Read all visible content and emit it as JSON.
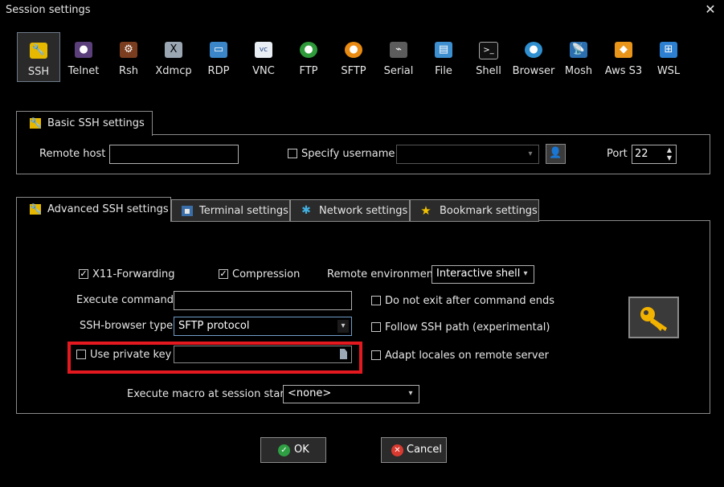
{
  "window": {
    "title": "Session settings",
    "close_label": "✕"
  },
  "protocols": [
    {
      "label": "SSH",
      "icon": "ssh-wrench-icon",
      "active": true
    },
    {
      "label": "Telnet",
      "icon": "telnet-icon"
    },
    {
      "label": "Rsh",
      "icon": "rsh-icon"
    },
    {
      "label": "Xdmcp",
      "icon": "xdmcp-icon"
    },
    {
      "label": "RDP",
      "icon": "rdp-icon"
    },
    {
      "label": "VNC",
      "icon": "vnc-icon"
    },
    {
      "label": "FTP",
      "icon": "ftp-icon"
    },
    {
      "label": "SFTP",
      "icon": "sftp-icon"
    },
    {
      "label": "Serial",
      "icon": "serial-icon"
    },
    {
      "label": "File",
      "icon": "file-icon"
    },
    {
      "label": "Shell",
      "icon": "shell-icon"
    },
    {
      "label": "Browser",
      "icon": "browser-icon"
    },
    {
      "label": "Mosh",
      "icon": "mosh-icon"
    },
    {
      "label": "Aws S3",
      "icon": "aws-s3-icon"
    },
    {
      "label": "WSL",
      "icon": "wsl-icon"
    }
  ],
  "basic": {
    "tab_label": "Basic SSH settings",
    "remote_host_label": "Remote host *",
    "remote_host_value": "",
    "specify_username_label": "Specify username",
    "specify_username_checked": false,
    "username_value": "",
    "port_label": "Port",
    "port_value": "22"
  },
  "tabs": [
    {
      "label": "Advanced SSH settings",
      "active": true
    },
    {
      "label": "Terminal settings"
    },
    {
      "label": "Network settings"
    },
    {
      "label": "Bookmark settings"
    }
  ],
  "advanced": {
    "x11_label": "X11-Forwarding",
    "x11_checked": true,
    "compression_label": "Compression",
    "compression_checked": true,
    "remote_env_label": "Remote environment:",
    "remote_env_value": "Interactive shell",
    "execute_command_label": "Execute command:",
    "execute_command_value": "",
    "do_not_exit_label": "Do not exit after command ends",
    "do_not_exit_checked": false,
    "browser_type_label": "SSH-browser type:",
    "browser_type_value": "SFTP protocol",
    "follow_path_label": "Follow SSH path (experimental)",
    "follow_path_checked": false,
    "private_key_label": "Use private key",
    "private_key_checked": false,
    "private_key_value": "",
    "adapt_locales_label": "Adapt locales on remote server",
    "adapt_locales_checked": false,
    "macro_label": "Execute macro at session start:",
    "macro_value": "<none>"
  },
  "buttons": {
    "ok_label": "OK",
    "cancel_label": "Cancel"
  },
  "colors": {
    "highlight_box": "#e4191f",
    "ok_green": "#2ea043",
    "cancel_red": "#d83a2f",
    "key_gold": "#f2b200"
  }
}
